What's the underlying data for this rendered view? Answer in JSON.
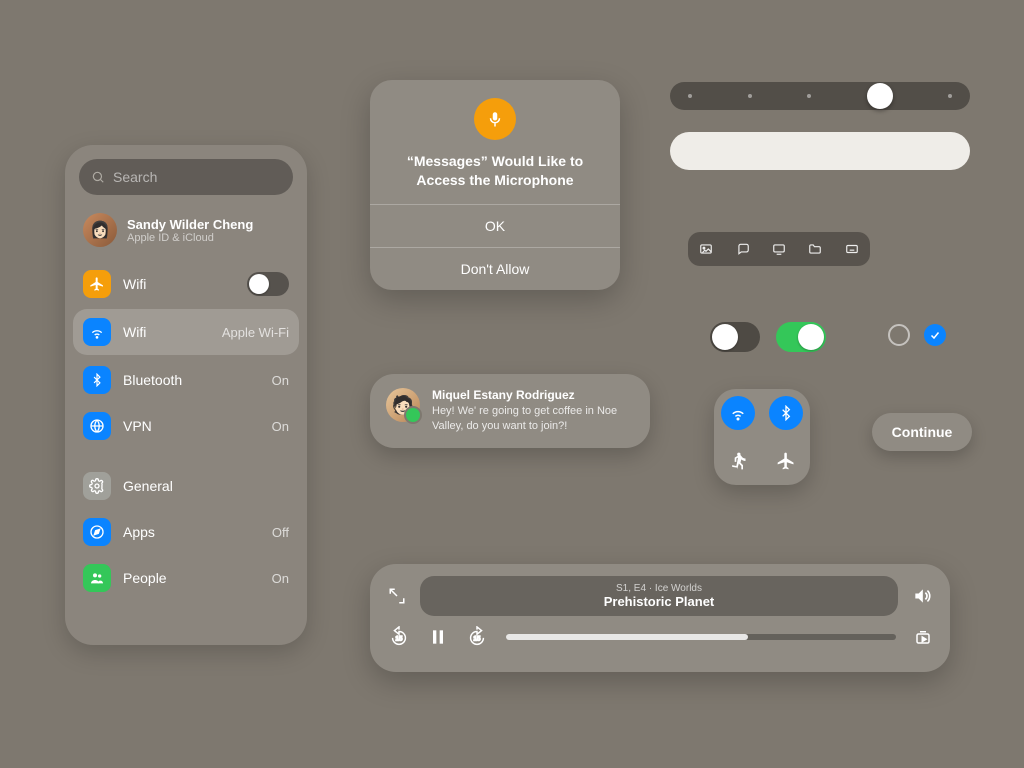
{
  "panel": {
    "search_placeholder": "Search",
    "profile": {
      "name": "Sandy Wilder Cheng",
      "sub": "Apple ID & iCloud"
    },
    "rows": [
      {
        "icon": "airplane",
        "color": "orange",
        "label": "Wifi",
        "trailing": "toggle-off"
      },
      {
        "icon": "wifi",
        "color": "blue",
        "label": "Wifi",
        "value": "Apple Wi-Fi",
        "selected": true
      },
      {
        "icon": "bluetooth",
        "color": "blue",
        "label": "Bluetooth",
        "value": "On"
      },
      {
        "icon": "globe",
        "color": "blue",
        "label": "VPN",
        "value": "On"
      },
      {
        "divider": true
      },
      {
        "icon": "gear",
        "color": "gray",
        "label": "General"
      },
      {
        "icon": "compass",
        "color": "blue",
        "label": "Apps",
        "value": "Off"
      },
      {
        "icon": "people",
        "color": "green",
        "label": "People",
        "value": "On"
      }
    ]
  },
  "alert": {
    "title": "“Messages” Would Like to Access the Microphone",
    "primary": "OK",
    "secondary": "Don't Allow"
  },
  "pager": {
    "pages": 5,
    "current_index": 3
  },
  "toolbar_icons": [
    "photo",
    "message",
    "display",
    "folder",
    "keyboard"
  ],
  "switches": {
    "left": "off",
    "right": "on"
  },
  "radio_checked": false,
  "checkbox_checked": true,
  "notification": {
    "name": "Miquel Estany Rodriguez",
    "message": "Hey! We' re going to get coffee in Noe Valley, do you want to join?!"
  },
  "control_center": [
    "wifi",
    "bluetooth",
    "walking",
    "airplane"
  ],
  "continue_label": "Continue",
  "media": {
    "subtitle": "S1, E4 · Ice Worlds",
    "title": "Prehistoric Planet",
    "progress": 0.62,
    "skip_seconds": 15
  }
}
